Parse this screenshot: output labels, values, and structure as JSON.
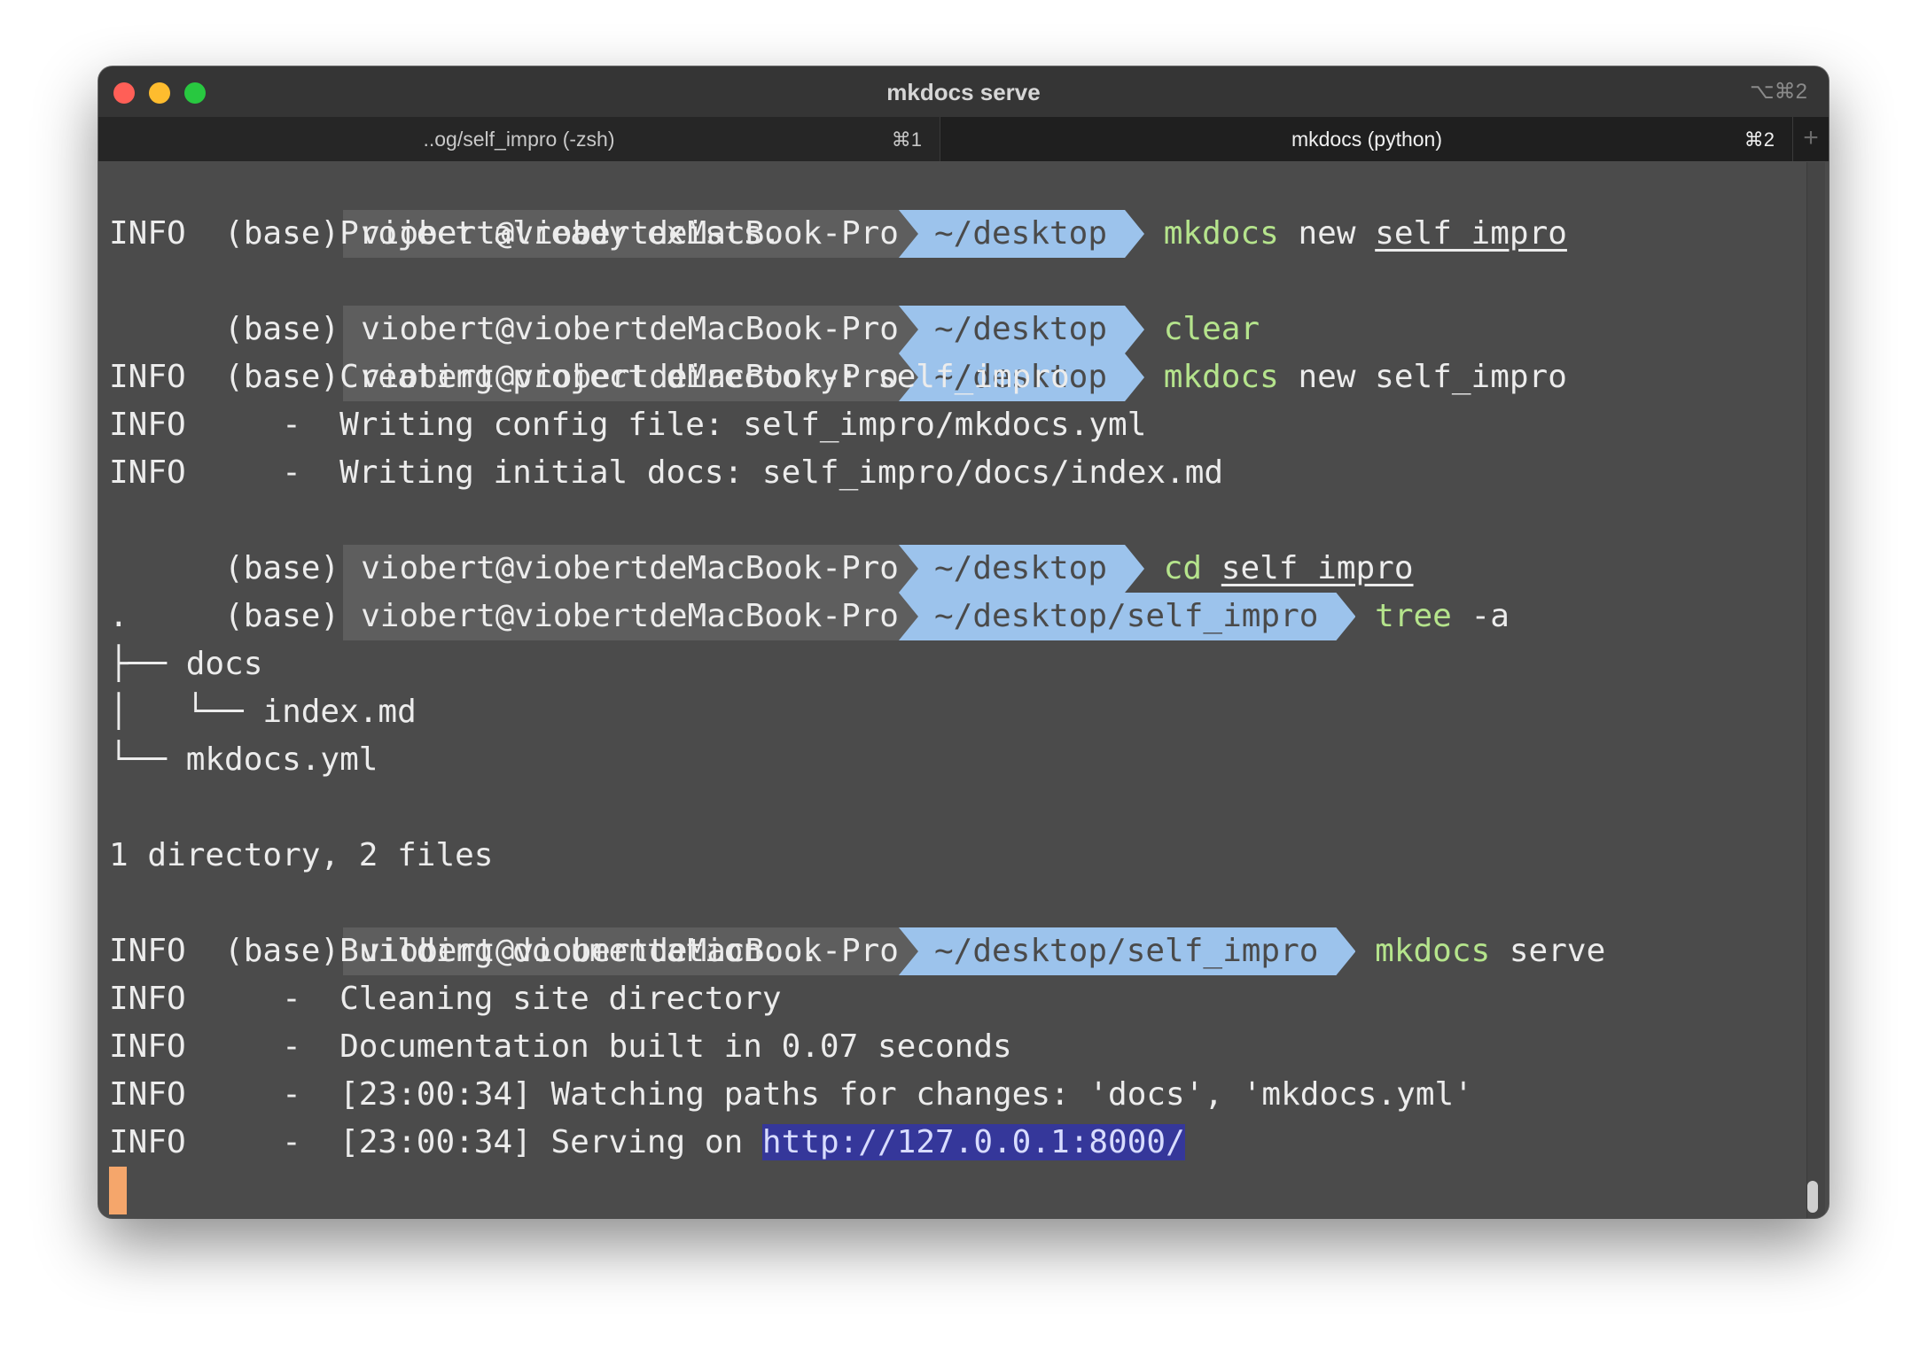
{
  "window": {
    "title": "mkdocs serve",
    "title_shortcut": "⌥⌘2"
  },
  "tabs": [
    {
      "label": "..og/self_impro (-zsh)",
      "shortcut": "⌘1"
    },
    {
      "label": "mkdocs (python)",
      "shortcut": "⌘2"
    }
  ],
  "new_tab": "+",
  "prompt": {
    "env": "(base)",
    "user": "viobert@viobertdeMacBook-Pro",
    "dir_desktop": "~/desktop",
    "dir_project": "~/desktop/self_impro"
  },
  "lines": [
    {
      "cmd": "mkdocs",
      "args": "new",
      "arg2": "self_impro"
    },
    {
      "text": "INFO     -  Project already exists."
    },
    {
      "cmd": "clear"
    },
    {
      "cmd": "mkdocs",
      "args": "new self_impro"
    },
    {
      "text": "INFO     -  Creating project directory: self_impro"
    },
    {
      "text": "INFO     -  Writing config file: self_impro/mkdocs.yml"
    },
    {
      "text": "INFO     -  Writing initial docs: self_impro/docs/index.md"
    },
    {
      "cmd": "cd",
      "arg2": "self_impro"
    },
    {
      "cmd": "tree",
      "args": "-a"
    },
    {
      "text": "."
    },
    {
      "text": "├── docs"
    },
    {
      "text": "│   └── index.md"
    },
    {
      "text": "└── mkdocs.yml"
    },
    {
      "text": ""
    },
    {
      "text": "1 directory, 2 files"
    },
    {
      "cmd": "mkdocs",
      "args": "serve"
    },
    {
      "text": "INFO     -  Building documentation..."
    },
    {
      "text": "INFO     -  Cleaning site directory"
    },
    {
      "text": "INFO     -  Documentation built in 0.07 seconds"
    },
    {
      "text": "INFO     -  [23:00:34] Watching paths for changes: 'docs', 'mkdocs.yml'"
    },
    {
      "prefix": "INFO     -  [23:00:34] Serving on ",
      "link": "http://127.0.0.1:8000/"
    }
  ],
  "colors": {
    "background": "#4b4b4b",
    "command": "#b5e48c",
    "dir_segment": "#9cc3ec",
    "user_segment": "#5e5e5e",
    "link_highlight": "#35379a",
    "cursor": "#f5a66b"
  }
}
